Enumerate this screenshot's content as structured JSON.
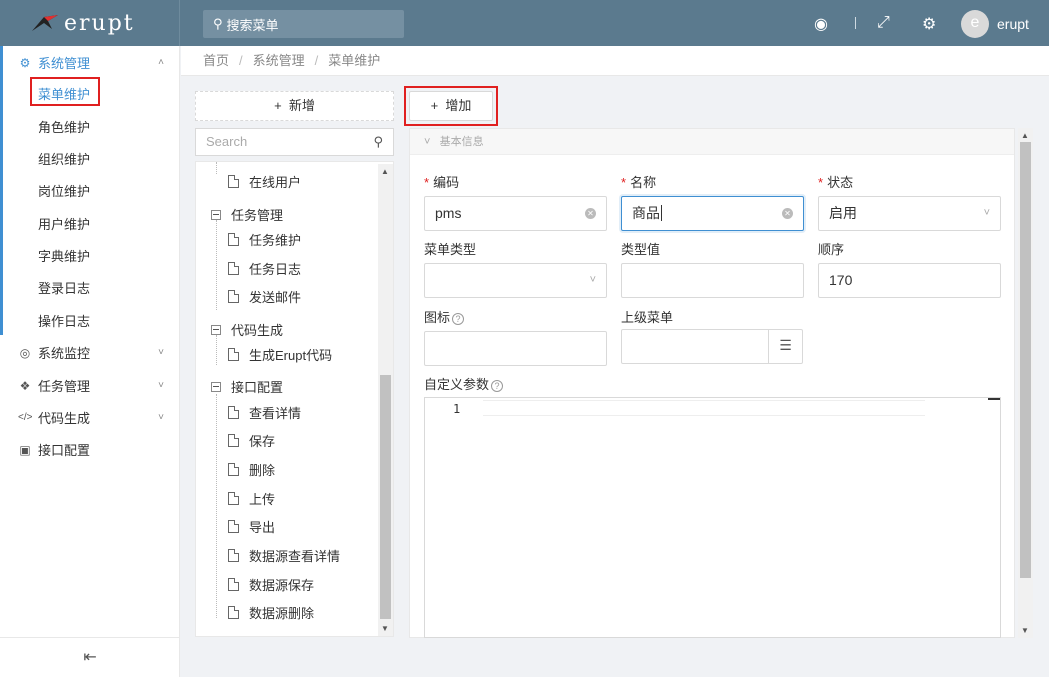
{
  "header": {
    "logo_text": "erupt",
    "search_placeholder": "搜索菜单",
    "username": "erupt",
    "avatar_letter": "e",
    "brand_color": "#5b7a8e"
  },
  "sidebar": {
    "groups": [
      {
        "label": "系统管理",
        "icon": "gears-icon",
        "open": true
      },
      {
        "label": "系统监控",
        "icon": "monitor-icon"
      },
      {
        "label": "任务管理",
        "icon": "cubes-icon"
      },
      {
        "label": "代码生成",
        "icon": "code-icon"
      },
      {
        "label": "接口配置",
        "icon": "cube-icon"
      }
    ],
    "items": [
      "菜单维护",
      "角色维护",
      "组织维护",
      "岗位维护",
      "用户维护",
      "字典维护",
      "登录日志",
      "操作日志"
    ],
    "collapse_icon": "outdent-icon"
  },
  "breadcrumb": [
    "首页",
    "系统管理",
    "菜单维护"
  ],
  "tree": {
    "add_label": "新增",
    "search_placeholder": "Search",
    "nodes": {
      "n0": "在线用户",
      "g1": "任务管理",
      "n1": "任务维护",
      "n2": "任务日志",
      "n3": "发送邮件",
      "g2": "代码生成",
      "n4": "生成Erupt代码",
      "g3": "接口配置",
      "n5": "查看详情",
      "n6": "保存",
      "n7": "删除",
      "n8": "上传",
      "n9": "导出",
      "n10": "数据源查看详情",
      "n11": "数据源保存",
      "n12": "数据源删除"
    }
  },
  "form": {
    "add_button": "增加",
    "section_title": "基本信息",
    "fields": {
      "code_label": "编码",
      "code_value": "pms",
      "name_label": "名称",
      "name_value": "商品",
      "status_label": "状态",
      "status_value": "启用",
      "menu_type_label": "菜单类型",
      "menu_type_value": "",
      "type_value_label": "类型值",
      "type_value_value": "",
      "order_label": "顺序",
      "order_value": "170",
      "icon_label": "图标",
      "icon_value": "",
      "parent_label": "上级菜单",
      "parent_value": "",
      "params_label": "自定义参数"
    },
    "editor_line": "1"
  }
}
